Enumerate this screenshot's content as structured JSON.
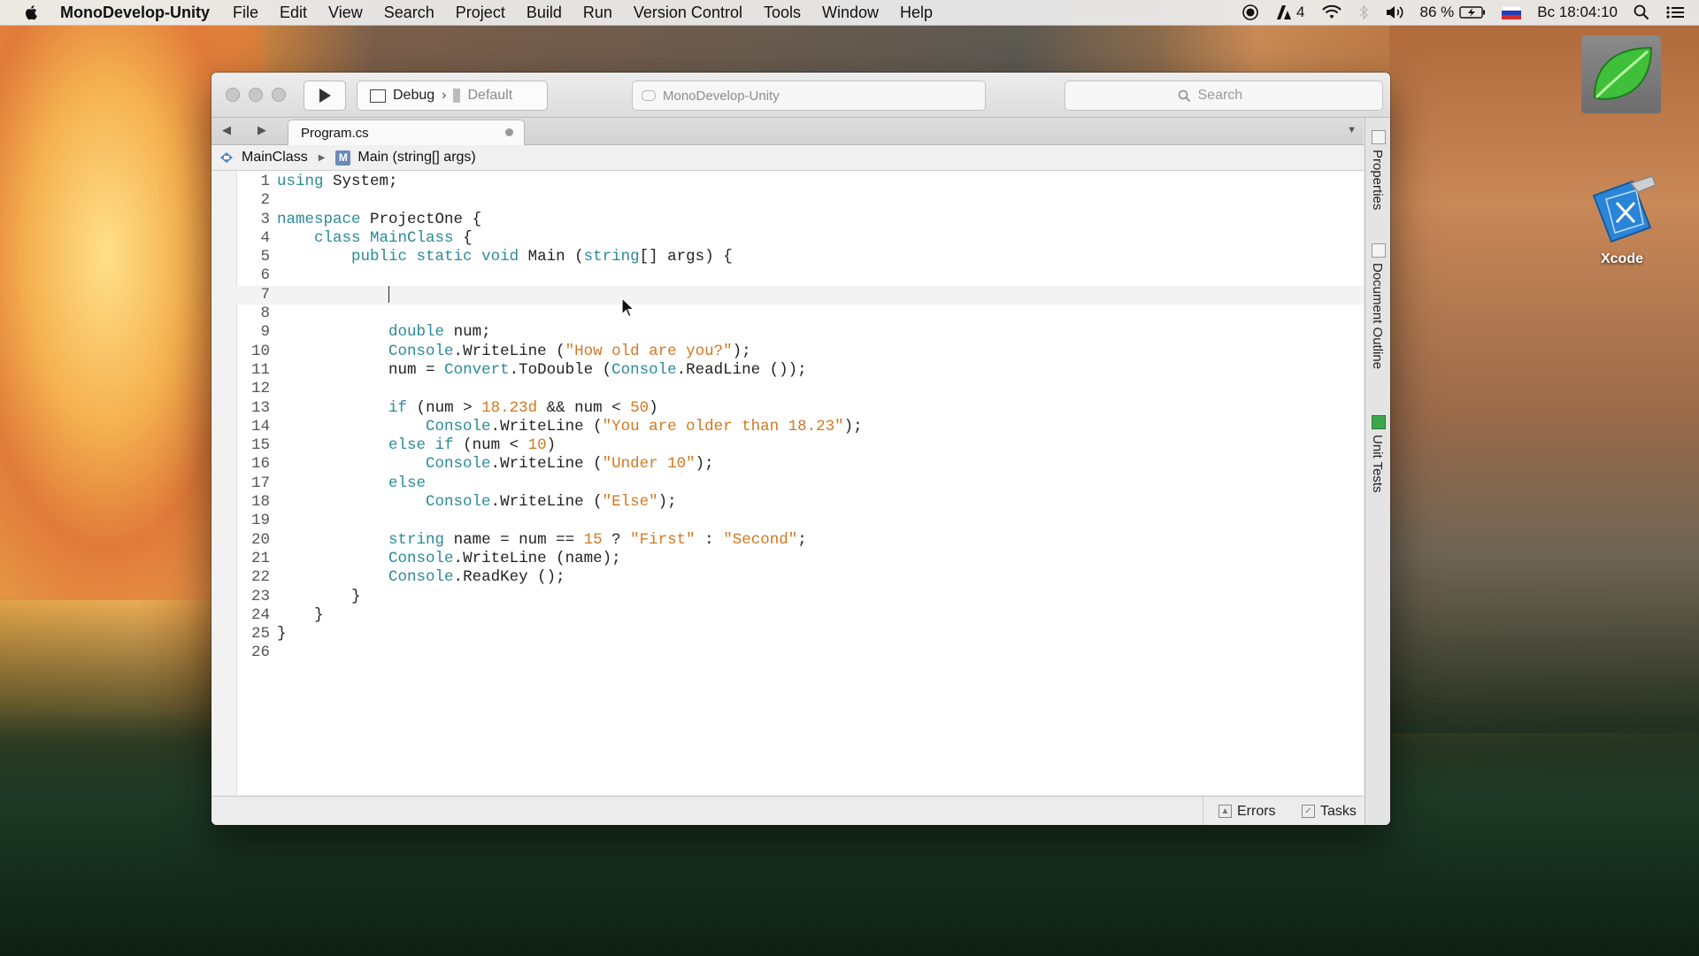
{
  "menubar": {
    "app_name": "MonoDevelop-Unity",
    "items": [
      "File",
      "Edit",
      "View",
      "Search",
      "Project",
      "Build",
      "Run",
      "Version Control",
      "Tools",
      "Window",
      "Help"
    ],
    "adobe_count": "4",
    "battery": "86 %",
    "clock": "Вс 18:04:10"
  },
  "desktop": {
    "xcode_label": "Xcode"
  },
  "toolbar": {
    "config": "Debug",
    "device": "Default",
    "status_title": "MonoDevelop-Unity",
    "search_placeholder": "Search"
  },
  "tabs": [
    {
      "label": "Program.cs"
    }
  ],
  "pathbar": {
    "class_name": "MainClass",
    "method_name": "Main (string[] args)"
  },
  "code": {
    "lines": [
      "using System;",
      "",
      "namespace ProjectOne {",
      "    class MainClass {",
      "        public static void Main (string[] args) {",
      "",
      "            ",
      "",
      "            double num;",
      "            Console.WriteLine (\"How old are you?\");",
      "            num = Convert.ToDouble (Console.ReadLine ());",
      "",
      "            if (num > 18.23d && num < 50)",
      "                Console.WriteLine (\"You are older than 18.23\");",
      "            else if (num < 10)",
      "                Console.WriteLine (\"Under 10\");",
      "            else",
      "                Console.WriteLine (\"Else\");",
      "",
      "            string name = num == 15 ? \"First\" : \"Second\";",
      "            Console.WriteLine (name);",
      "            Console.ReadKey ();",
      "        }",
      "    }",
      "}",
      ""
    ],
    "current_line": 7
  },
  "bottom_pads": {
    "errors_label": "Errors",
    "tasks_label": "Tasks"
  },
  "right_pads": {
    "properties": "Properties",
    "document_outline": "Document Outline",
    "unit_tests": "Unit Tests"
  },
  "colors": {
    "keyword": "#2b8a99",
    "string": "#d3771f"
  }
}
